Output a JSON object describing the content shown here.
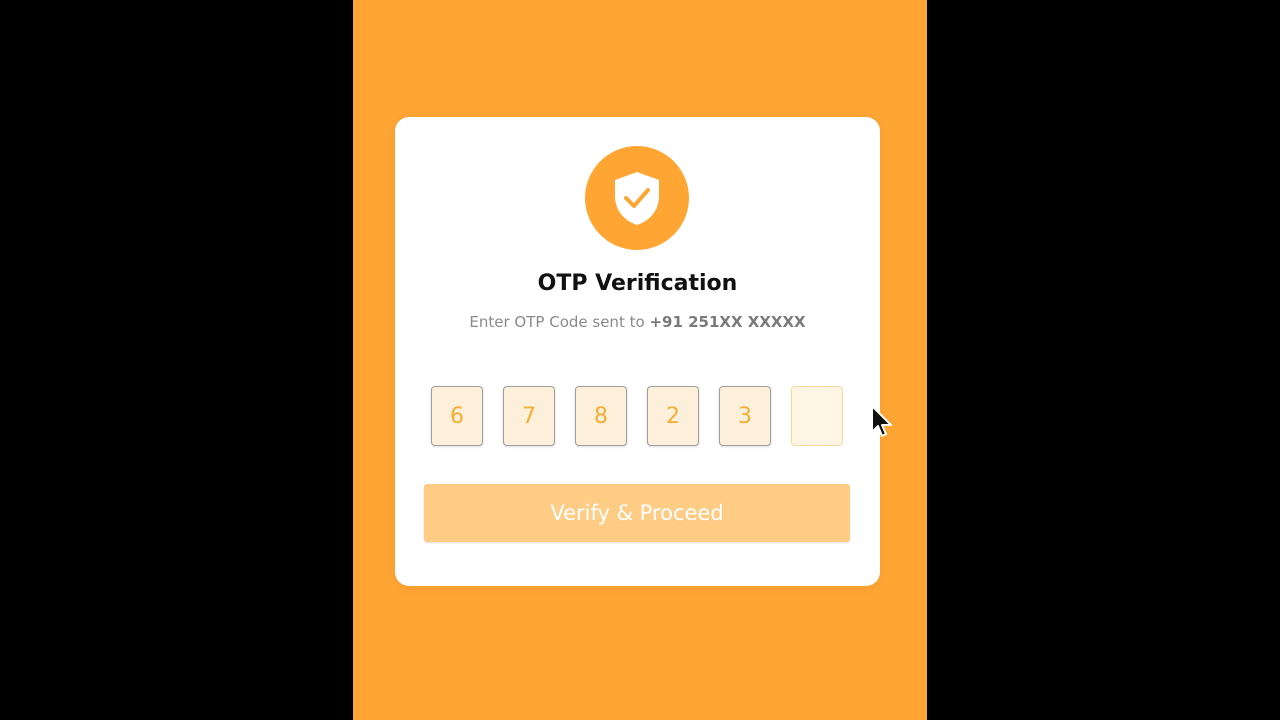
{
  "card": {
    "title": "OTP Verification",
    "subtitle_prefix": "Enter OTP Code sent to",
    "phone": "+91 251XX XXXXX",
    "badge_icon": "shield-check-icon"
  },
  "otp": {
    "digits": [
      "6",
      "7",
      "8",
      "2",
      "3",
      ""
    ]
  },
  "button": {
    "label": "Verify & Proceed"
  },
  "colors": {
    "accent": "#FFA534",
    "button_disabled": "#FFCC85",
    "digit_text": "#F4AE36",
    "digit_bg": "#FDF0DA"
  }
}
